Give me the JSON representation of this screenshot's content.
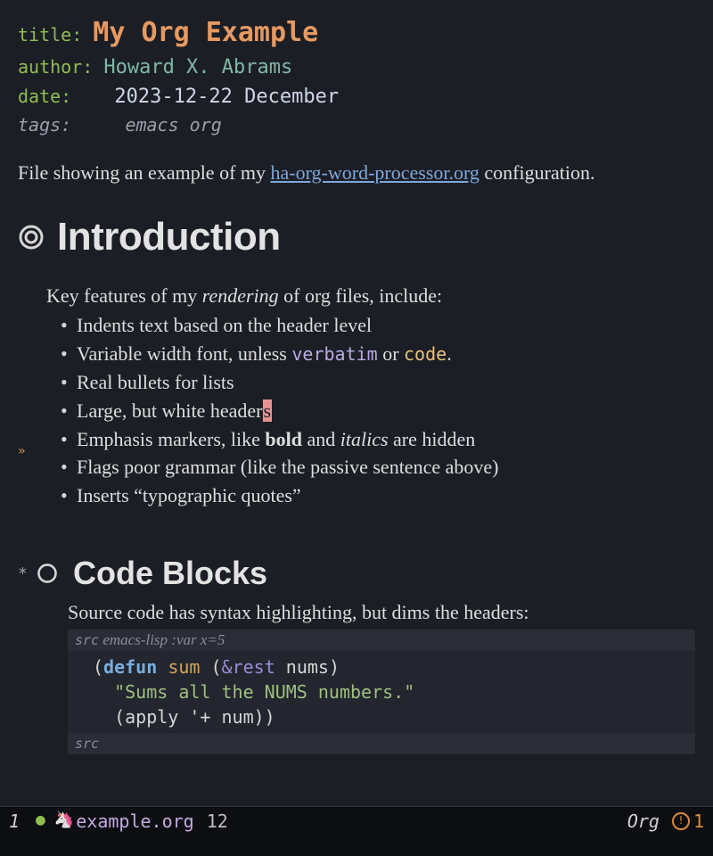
{
  "meta": {
    "title_key": "title:",
    "title": "My Org Example",
    "author_key": "author:",
    "author": "Howard X. Abrams",
    "date_key": "date:",
    "date": "2023-12-22 December",
    "tags_key": "tags:",
    "tags": "emacs org"
  },
  "intro": {
    "prefix": "File showing an example of my ",
    "link": "ha-org-word-processor.org",
    "suffix": " configuration."
  },
  "headings": {
    "h1": "Introduction",
    "h2": "Code Blocks",
    "h2_star": "*"
  },
  "para1": {
    "t1": "Key features of my ",
    "em": "rendering",
    "t2": " of org files, include:"
  },
  "list": {
    "i0": "Indents text based on the header level",
    "i1a": "Variable width font, unless ",
    "i1_verb": "verbatim",
    "i1b": " or ",
    "i1_code": "code",
    "i1c": ".",
    "i2": "Real bullets for lists",
    "i3a": "Large, but white header",
    "i3_cursor": "s",
    "i4a": "Emphasis markers, like ",
    "i4_bold": "bold",
    "i4b": " and ",
    "i4_it": "italics",
    "i4c": " are hidden",
    "i5": "Flags poor grammar (like the passive sentence above)",
    "i6": "Inserts “typographic quotes”"
  },
  "code": {
    "intro": "Source code has syntax highlighting, but dims the headers:",
    "header_src": "src",
    "header_rest": " emacs-lisp :var x=5",
    "footer": "src",
    "l1_open": "(",
    "l1_kw": "defun",
    "l1_sp": " ",
    "l1_fn": "sum",
    "l1_sp2": " (",
    "l1_amp": "&rest",
    "l1_args": " nums)",
    "l2": "  \"Sums all the NUMS numbers.\"",
    "l3": "  (apply '+ num))"
  },
  "modeline": {
    "window": "1",
    "filename": "example.org",
    "position": "12",
    "major": "Org",
    "warn_count": "1"
  },
  "gutter": {
    "mark": "»"
  }
}
